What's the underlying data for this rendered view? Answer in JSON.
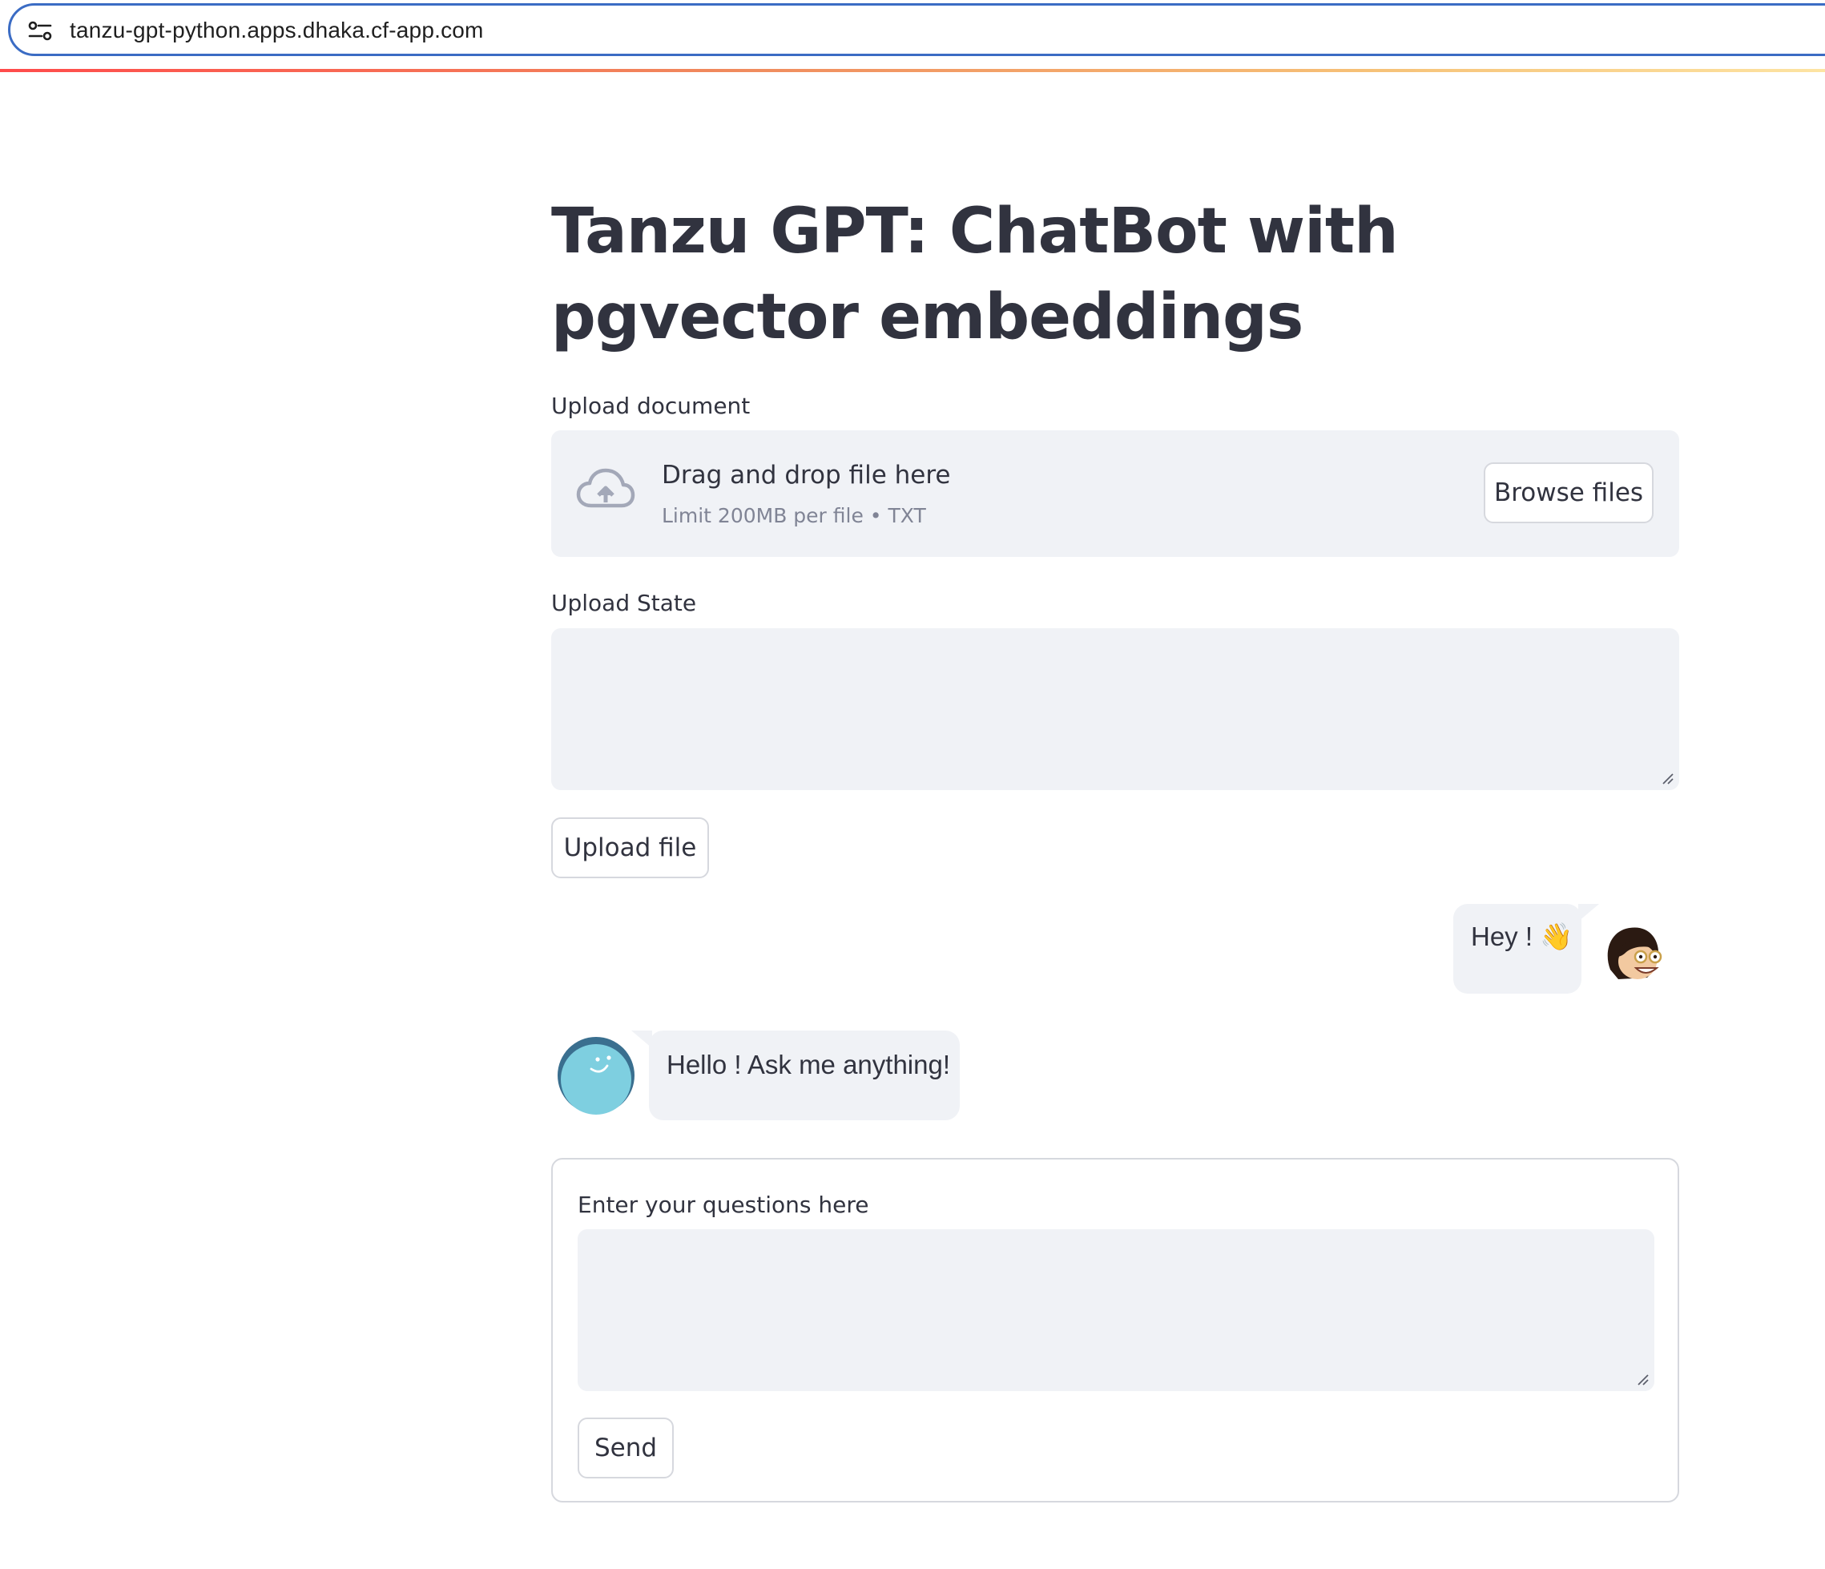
{
  "browser": {
    "url": "tanzu-gpt-python.apps.dhaka.cf-app.com",
    "site_settings_icon": "tune-icon"
  },
  "page": {
    "title": "Tanzu GPT: ChatBot with pgvector embeddings"
  },
  "uploader": {
    "label": "Upload document",
    "drop_text": "Drag and drop file here",
    "limit_text": "Limit 200MB per file • TXT",
    "browse_label": "Browse files",
    "icon": "cloud-upload-icon"
  },
  "upload_state": {
    "label": "Upload State",
    "value": ""
  },
  "upload_button": {
    "label": "Upload file"
  },
  "chat": {
    "messages": [
      {
        "role": "user",
        "text": "Hey ! 👋",
        "avatar": "user-avatar-icon"
      },
      {
        "role": "bot",
        "text": "Hello ! Ask me anything!",
        "avatar": "bot-avatar-icon"
      }
    ]
  },
  "question_form": {
    "label": "Enter your questions here",
    "value": "",
    "send_label": "Send"
  },
  "colors": {
    "accent_stripe_start": "#ff4b4b",
    "accent_stripe_end": "#fde4a3",
    "input_bg": "#f0f2f6",
    "text": "#31333f",
    "url_focus": "#3b6cc4"
  }
}
